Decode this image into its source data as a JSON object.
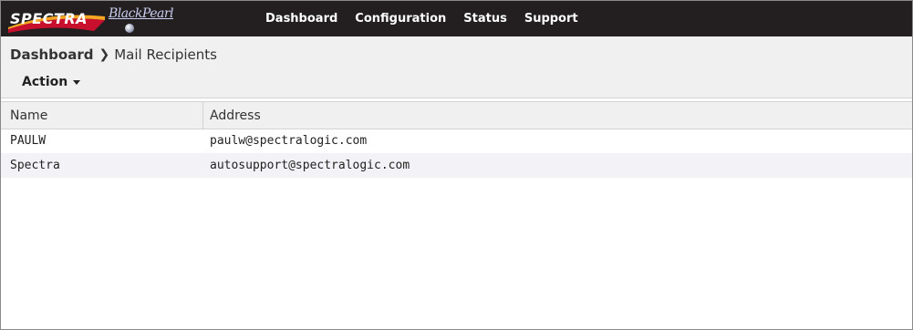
{
  "brand": {
    "primary": "SPECTRA",
    "secondary": "BlackPearl"
  },
  "nav": {
    "items": [
      {
        "label": "Dashboard"
      },
      {
        "label": "Configuration"
      },
      {
        "label": "Status"
      },
      {
        "label": "Support"
      }
    ]
  },
  "breadcrumb": {
    "root": "Dashboard",
    "separator": "❯",
    "current": "Mail Recipients"
  },
  "toolbar": {
    "action_label": "Action"
  },
  "table": {
    "columns": [
      "Name",
      "Address"
    ],
    "rows": [
      {
        "name": "PAULW",
        "address": "paulw@spectralogic.com"
      },
      {
        "name": "Spectra",
        "address": "autosupport@spectralogic.com"
      }
    ]
  },
  "colors": {
    "topbar": "#231f20",
    "header_bg": "#f0f0f0",
    "alt_row": "#f3f3f7"
  }
}
